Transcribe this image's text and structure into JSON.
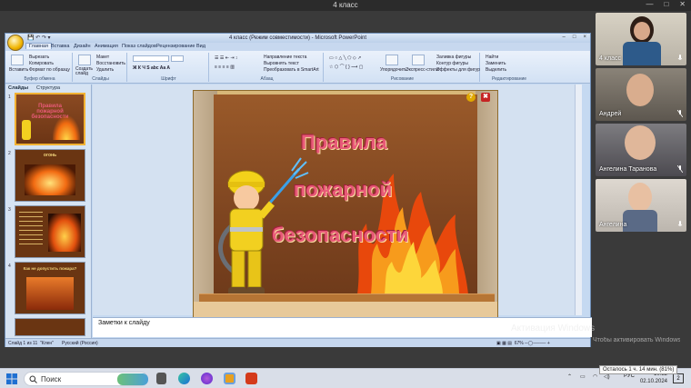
{
  "meeting": {
    "title": "4 класс"
  },
  "window": {
    "title": "4 класс (Режим совместимости) - Microsoft PowerPoint"
  },
  "ribbon": {
    "tabs": [
      "Главная",
      "Вставка",
      "Дизайн",
      "Анимация",
      "Показ слайдов",
      "Рецензирование",
      "Вид"
    ],
    "clipboard": {
      "paste": "Вставить",
      "cut": "Вырезать",
      "copy": "Копировать",
      "format": "Формат по образцу",
      "label": "Буфер обмена"
    },
    "slides": {
      "new": "Создать слайд",
      "layout": "Макет",
      "reset": "Восстановить",
      "delete": "Удалить",
      "label": "Слайды"
    },
    "font": {
      "label": "Шрифт"
    },
    "paragraph": {
      "direction": "Направление текста",
      "align": "Выровнять текст",
      "smartart": "Преобразовать в SmartArt",
      "label": "Абзац"
    },
    "drawing": {
      "arrange": "Упорядочить",
      "styles": "Экспресс-стили",
      "fill": "Заливка фигуры",
      "outline": "Контур фигуры",
      "effects": "Эффекты для фигур",
      "label": "Рисование"
    },
    "editing": {
      "find": "Найти",
      "replace": "Заменить",
      "select": "Выделить",
      "label": "Редактирование"
    }
  },
  "panel": {
    "tabs": [
      "Слайды",
      "Структура"
    ],
    "thumbs": [
      {
        "num": "1",
        "title": "Правила пожарной безопасности"
      },
      {
        "num": "2",
        "title": "огонь"
      },
      {
        "num": "3",
        "title": ""
      },
      {
        "num": "4",
        "title": "Как не допустить пожара?"
      }
    ]
  },
  "slide": {
    "line1": "Правила",
    "line2": "пожарной",
    "line3": "безопасности",
    "help": "?",
    "close": "✖"
  },
  "notes": {
    "placeholder": "Заметки к слайду"
  },
  "status": {
    "slide": "Слайд 1 из 11",
    "theme": "\"Клен\"",
    "lang": "Русский (Россия)"
  },
  "watermark": {
    "title": "Активация Windows",
    "sub": "Чтобы активировать Windows, перейдите в раздел"
  },
  "participants": [
    {
      "name": "4 класс",
      "muted": false
    },
    {
      "name": "Андрей",
      "muted": true
    },
    {
      "name": "Ангелина Таранова",
      "muted": true
    },
    {
      "name": "Ангелина",
      "muted": false
    }
  ],
  "taskbar": {
    "search": "Поиск",
    "lang": "РУС",
    "time": "10:32",
    "date": "02.10.2024",
    "badge": "2",
    "battery_tooltip": "Осталось 1 ч. 14 мин. (81%)"
  }
}
